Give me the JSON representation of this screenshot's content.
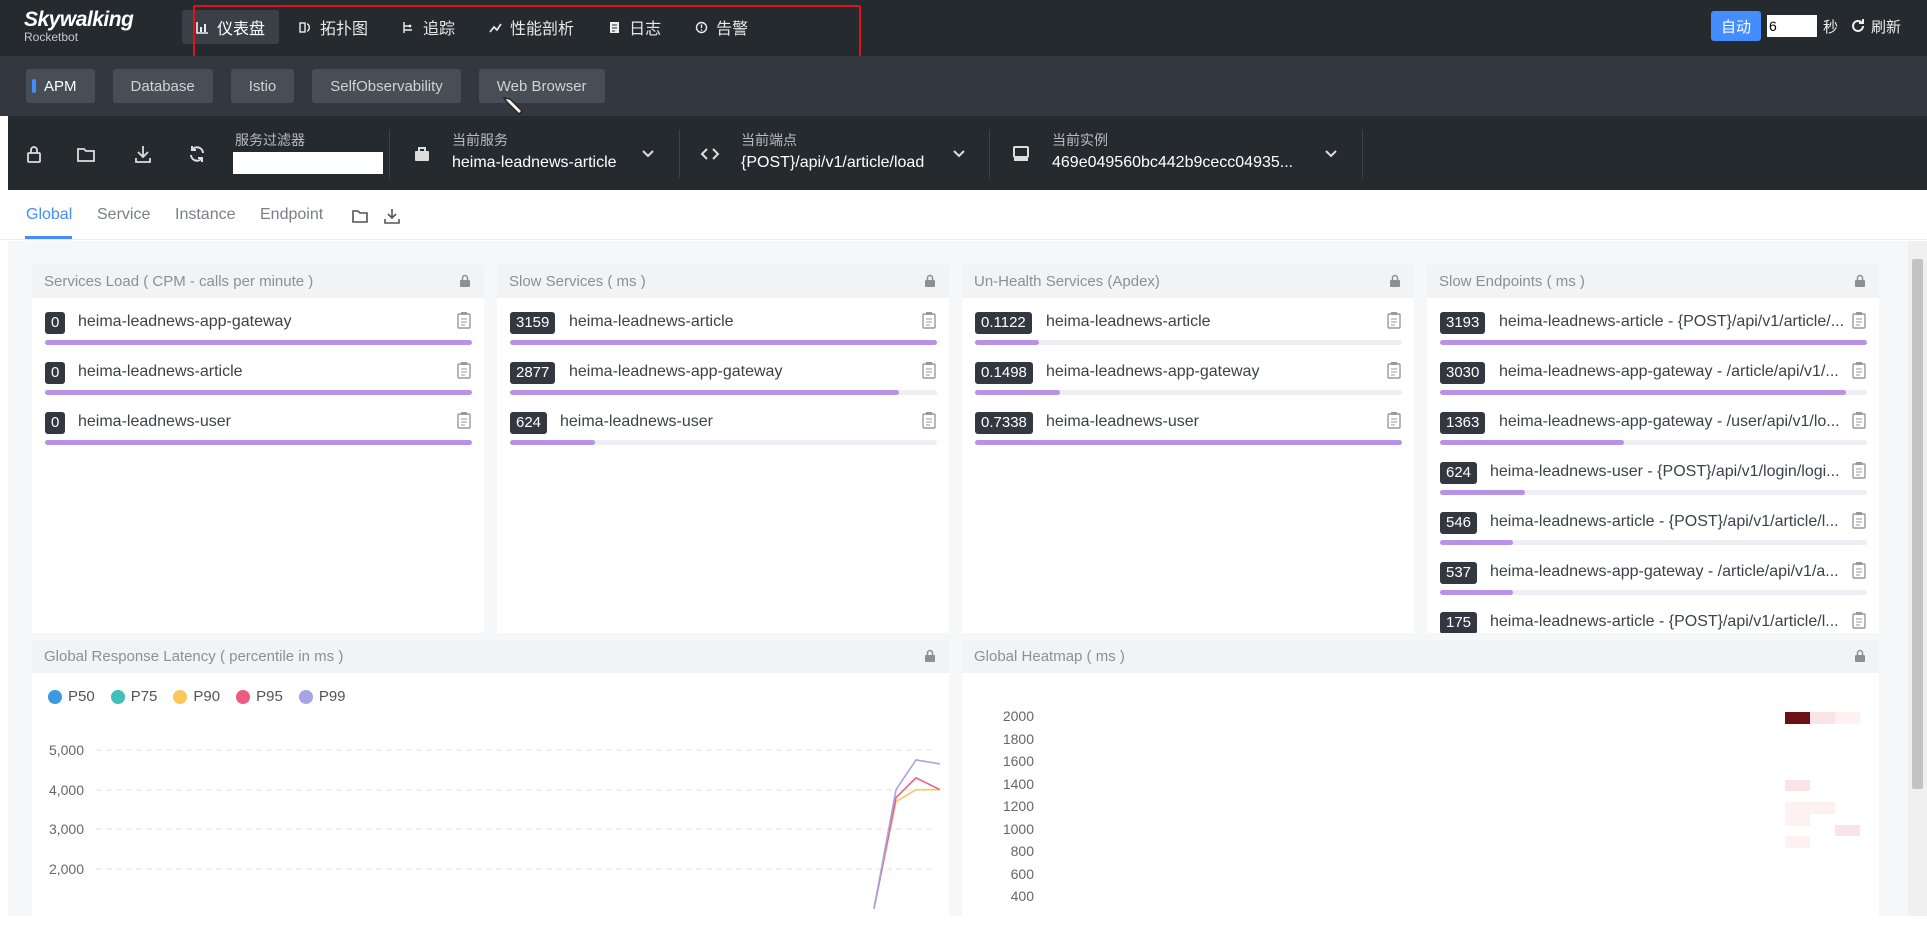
{
  "brand": {
    "name": "Skywalking",
    "sub": "Rocketbot"
  },
  "nav": [
    {
      "label": "仪表盘",
      "icon": "dashboard-icon",
      "active": true
    },
    {
      "label": "拓扑图",
      "icon": "topology-icon"
    },
    {
      "label": "追踪",
      "icon": "trace-icon"
    },
    {
      "label": "性能剖析",
      "icon": "profile-icon"
    },
    {
      "label": "日志",
      "icon": "log-icon"
    },
    {
      "label": "告警",
      "icon": "alarm-icon"
    }
  ],
  "topright": {
    "auto_label": "自动",
    "interval_value": "6",
    "seconds_label": "秒",
    "refresh_label": "刷新"
  },
  "groups": [
    {
      "label": "APM",
      "active": true
    },
    {
      "label": "Database"
    },
    {
      "label": "Istio"
    },
    {
      "label": "SelfObservability"
    },
    {
      "label": "Web Browser"
    }
  ],
  "toolbar": {
    "filter_label": "服务过滤器",
    "filter_value": "",
    "service": {
      "label": "当前服务",
      "value": "heima-leadnews-article"
    },
    "endpoint": {
      "label": "当前端点",
      "value": "{POST}/api/v1/article/load"
    },
    "instance": {
      "label": "当前实例",
      "value": "469e049560bc442b9cecc04935..."
    }
  },
  "page_tabs": [
    "Global",
    "Service",
    "Instance",
    "Endpoint"
  ],
  "panels": {
    "services_load": {
      "title": "Services Load ( CPM - calls per minute )",
      "rows": [
        {
          "value": "0",
          "name": "heima-leadnews-app-gateway",
          "fill": 1.0
        },
        {
          "value": "0",
          "name": "heima-leadnews-article",
          "fill": 1.0
        },
        {
          "value": "0",
          "name": "heima-leadnews-user",
          "fill": 1.0
        }
      ]
    },
    "slow_services": {
      "title": "Slow Services ( ms )",
      "rows": [
        {
          "value": "3159",
          "name": "heima-leadnews-article",
          "fill": 1.0
        },
        {
          "value": "2877",
          "name": "heima-leadnews-app-gateway",
          "fill": 0.91
        },
        {
          "value": "624",
          "name": "heima-leadnews-user",
          "fill": 0.2
        }
      ]
    },
    "unhealth_services": {
      "title": "Un-Health Services (Apdex)",
      "rows": [
        {
          "value": "0.1122",
          "name": "heima-leadnews-article",
          "fill": 0.15
        },
        {
          "value": "0.1498",
          "name": "heima-leadnews-app-gateway",
          "fill": 0.2
        },
        {
          "value": "0.7338",
          "name": "heima-leadnews-user",
          "fill": 1.0
        }
      ]
    },
    "slow_endpoints": {
      "title": "Slow Endpoints ( ms )",
      "rows": [
        {
          "value": "3193",
          "name": "heima-leadnews-article - {POST}/api/v1/article/...",
          "fill": 1.0
        },
        {
          "value": "3030",
          "name": "heima-leadnews-app-gateway - /article/api/v1/...",
          "fill": 0.95
        },
        {
          "value": "1363",
          "name": "heima-leadnews-app-gateway - /user/api/v1/lo...",
          "fill": 0.43
        },
        {
          "value": "624",
          "name": "heima-leadnews-user - {POST}/api/v1/login/logi...",
          "fill": 0.2
        },
        {
          "value": "546",
          "name": "heima-leadnews-article - {POST}/api/v1/article/l...",
          "fill": 0.17
        },
        {
          "value": "537",
          "name": "heima-leadnews-app-gateway - /article/api/v1/a...",
          "fill": 0.17
        },
        {
          "value": "175",
          "name": "heima-leadnews-article - {POST}/api/v1/article/l...",
          "fill": 0.06
        }
      ]
    },
    "latency": {
      "title": "Global Response Latency ( percentile in ms )"
    },
    "heatmap": {
      "title": "Global Heatmap ( ms )"
    }
  },
  "chart_data": [
    {
      "type": "line",
      "title": "Global Response Latency ( percentile in ms )",
      "series": [
        {
          "name": "P50",
          "color": "#3b9ae1"
        },
        {
          "name": "P75",
          "color": "#40c0b8"
        },
        {
          "name": "P90",
          "color": "#fbc65a"
        },
        {
          "name": "P95",
          "color": "#ef5b80"
        },
        {
          "name": "P99",
          "color": "#a8a3e6"
        }
      ],
      "y_ticks": [
        "5,000",
        "4,000",
        "3,000",
        "2,000"
      ],
      "ylim": [
        1000,
        5500
      ],
      "visible_tail": {
        "P90": [
          1000,
          3700,
          4000,
          4000
        ],
        "P95": [
          1000,
          3800,
          4300,
          4000
        ],
        "P99": [
          1000,
          4000,
          4750,
          4650
        ]
      }
    },
    {
      "type": "heatmap",
      "title": "Global Heatmap ( ms )",
      "y_ticks": [
        "2000",
        "1800",
        "1600",
        "1400",
        "1200",
        "1000",
        "800",
        "600",
        "400"
      ],
      "ylim": [
        400,
        2000
      ]
    }
  ]
}
